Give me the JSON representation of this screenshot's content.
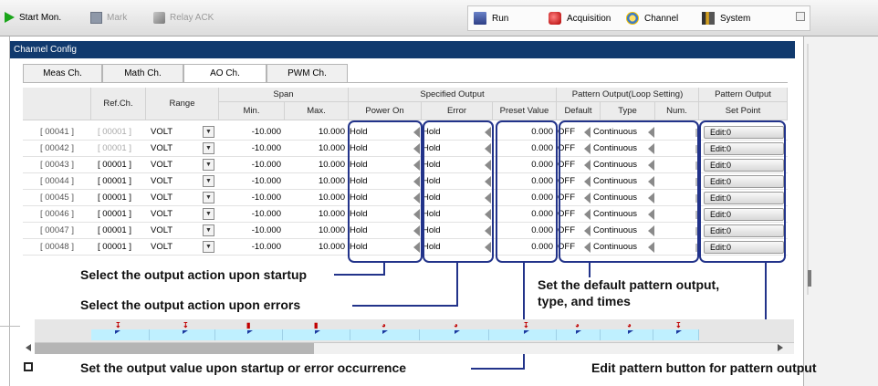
{
  "toolbar": {
    "start_mon": "Start Mon.",
    "mark": "Mark",
    "relay_ack": "Relay ACK",
    "tabs": [
      "Run",
      "Acquisition",
      "Channel",
      "System"
    ]
  },
  "window": {
    "title": "Channel Config"
  },
  "subtabs": [
    "Meas Ch.",
    "Math Ch.",
    "AO Ch.",
    "PWM Ch."
  ],
  "active_subtab": "AO Ch.",
  "headers": {
    "refch": "Ref.Ch.",
    "range": "Range",
    "span": "Span",
    "min": "Min.",
    "max": "Max.",
    "specified_output": "Specified Output",
    "power_on": "Power On",
    "error": "Error",
    "preset_value": "Preset Value",
    "pattern_loop": "Pattern Output(Loop Setting)",
    "default": "Default",
    "type": "Type",
    "num": "Num.",
    "pattern_output": "Pattern Output",
    "set_point": "Set Point"
  },
  "rows": [
    {
      "ch": "[ 00041 ]",
      "ref": "[ 00001 ]",
      "range": "VOLT",
      "min": "-10.000",
      "max": "10.000",
      "power_on": "Hold",
      "error": "Hold",
      "preset": "0.000",
      "default": "OFF",
      "type": "Continuous",
      "setpoint": "Edit:0"
    },
    {
      "ch": "[ 00042 ]",
      "ref": "[ 00001 ]",
      "range": "VOLT",
      "min": "-10.000",
      "max": "10.000",
      "power_on": "Hold",
      "error": "Hold",
      "preset": "0.000",
      "default": "OFF",
      "type": "Continuous",
      "setpoint": "Edit:0"
    },
    {
      "ch": "[ 00043 ]",
      "ref": "[ 00001 ]",
      "range": "VOLT",
      "min": "-10.000",
      "max": "10.000",
      "power_on": "Hold",
      "error": "Hold",
      "preset": "0.000",
      "default": "OFF",
      "type": "Continuous",
      "setpoint": "Edit:0"
    },
    {
      "ch": "[ 00044 ]",
      "ref": "[ 00001 ]",
      "range": "VOLT",
      "min": "-10.000",
      "max": "10.000",
      "power_on": "Hold",
      "error": "Hold",
      "preset": "0.000",
      "default": "OFF",
      "type": "Continuous",
      "setpoint": "Edit:0"
    },
    {
      "ch": "[ 00045 ]",
      "ref": "[ 00001 ]",
      "range": "VOLT",
      "min": "-10.000",
      "max": "10.000",
      "power_on": "Hold",
      "error": "Hold",
      "preset": "0.000",
      "default": "OFF",
      "type": "Continuous",
      "setpoint": "Edit:0"
    },
    {
      "ch": "[ 00046 ]",
      "ref": "[ 00001 ]",
      "range": "VOLT",
      "min": "-10.000",
      "max": "10.000",
      "power_on": "Hold",
      "error": "Hold",
      "preset": "0.000",
      "default": "OFF",
      "type": "Continuous",
      "setpoint": "Edit:0"
    },
    {
      "ch": "[ 00047 ]",
      "ref": "[ 00001 ]",
      "range": "VOLT",
      "min": "-10.000",
      "max": "10.000",
      "power_on": "Hold",
      "error": "Hold",
      "preset": "0.000",
      "default": "OFF",
      "type": "Continuous",
      "setpoint": "Edit:0"
    },
    {
      "ch": "[ 00048 ]",
      "ref": "[ 00001 ]",
      "range": "VOLT",
      "min": "-10.000",
      "max": "10.000",
      "power_on": "Hold",
      "error": "Hold",
      "preset": "0.000",
      "default": "OFF",
      "type": "Continuous",
      "setpoint": "Edit:0"
    }
  ],
  "annotations": {
    "startup": "Select the output action upon startup",
    "errors": "Select the output action upon errors",
    "preset": "Set the output value upon startup or error occurrence",
    "pattern_line1": "Set the default pattern output,",
    "pattern_line2": "type, and times",
    "edit_btn": "Edit pattern button for pattern output"
  },
  "colors": {
    "title_bar": "#113a6e",
    "highlight": "#22338a",
    "start_icon": "#1aa51a",
    "timeline": "#bff0ff"
  },
  "icons": {
    "start": "play-icon",
    "mark": "mark-icon",
    "relay": "relay-icon",
    "run": "run-icon",
    "acquisition": "acquisition-icon",
    "channel": "channel-icon",
    "system": "system-icon"
  }
}
